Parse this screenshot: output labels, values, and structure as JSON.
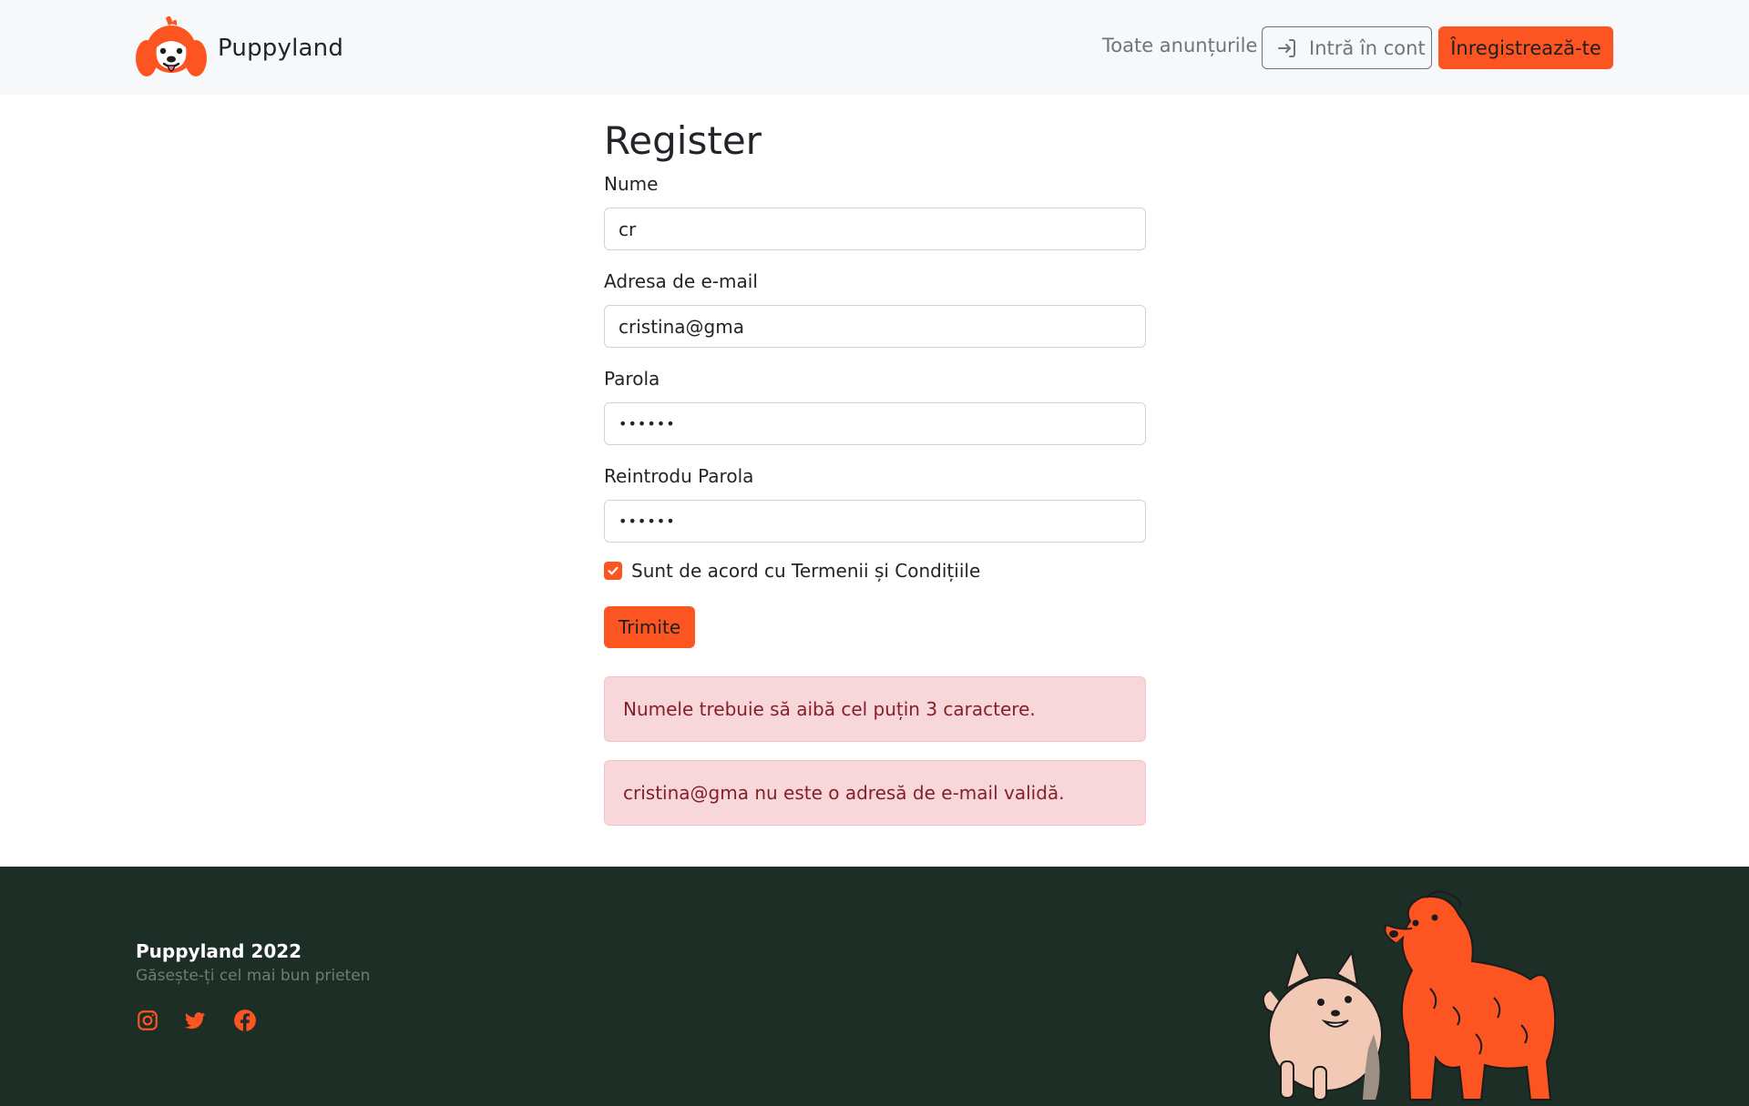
{
  "header": {
    "brand_name": "Puppyland",
    "logo_icon": "puppy-logo-icon",
    "nav_all_ads": "Toate anunțurile",
    "login_label": "Intră în cont",
    "login_icon": "sign-in-icon",
    "register_label": "Înregistrează-te"
  },
  "form": {
    "title": "Register",
    "name_label": "Nume",
    "name_value": "cr",
    "email_label": "Adresa de e-mail",
    "email_value": "cristina@gma",
    "password_label": "Parola",
    "password_value": "••••••",
    "confirm_label": "Reintrodu Parola",
    "confirm_value": "••••••",
    "terms_label": "Sunt de acord cu Termenii și Condițiile",
    "terms_checked": true,
    "submit_label": "Trimite"
  },
  "alerts": [
    "Numele trebuie să aibă cel puțin 3 caractere.",
    "cristina@gma nu este o adresă de e-mail validă."
  ],
  "footer": {
    "title": "Puppyland 2022",
    "subtitle": "Găsește-ți cel mai bun prieten",
    "social_icons": [
      "instagram-icon",
      "twitter-icon",
      "facebook-icon"
    ]
  },
  "colors": {
    "accent": "#fd5521",
    "navbar_bg": "#f7f8f9",
    "footer_bg": "#1c2e26",
    "alert_bg": "#f8d7da",
    "alert_text": "#842029"
  }
}
